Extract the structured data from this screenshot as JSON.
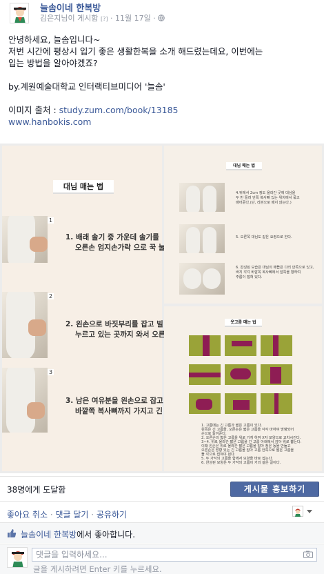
{
  "post": {
    "page_name": "늘솜이네 한복방",
    "author": "김은지님이 게시함",
    "mini_badge": "[?]",
    "dot": "·",
    "date": "11월 17일",
    "date_suffix": "·",
    "lines": [
      "안녕하세요, 늘솜입니다~",
      "저번 시간에 평상시 입기 좋은 생활한복을 소개 해드렸는데요, 이번에는",
      "입는 방법을 알아야겠죠?",
      "",
      "by.계원예술대학교 인터랙티브미디어 '늘솜'",
      ""
    ],
    "source_label": "이미지 출처 : ",
    "source_link": "study.zum.com/book/13185",
    "site_link": "www.hanbokis.com"
  },
  "media": {
    "left": {
      "title": "대님 매는 법",
      "steps": [
        {
          "num": "1",
          "line1": "1. 배래 솔기 중 가운데 솔기를",
          "line2": "오른손 엄지손가락 으로 꾹 눌"
        },
        {
          "num": "2",
          "line1": "2. 왼손으로 바짓부리를 잡고 빌",
          "line2": "누르고 있는 곳까지 와서 오른"
        },
        {
          "num": "3",
          "line1": "3. 남은 여유분을 왼손으로 잡고",
          "line2": "바깥쪽 복사뼈까지 가지고 긴"
        }
      ]
    },
    "top_right": {
      "title": "대님 매는 법",
      "steps": [
        {
          "l1": "4.뒤에서 2cm 정도 올라간 곳에 대님을",
          "l2": "두 번 돌려 안쪽 복사뼈 있는 위치에서 묶고",
          "l3": "매어준다.(단, 리본으로 매지 않는다.)"
        },
        {
          "l1": "5. 오른쪽 대님도 같은 요령으로 한다.",
          "l2": "",
          "l3": ""
        },
        {
          "l1": "6. 완성된 모습은 대님의 매듭은 다리 안쪽으로 있고,",
          "l2": "바지 각각 바깥쪽 복사뼈에서 앞쪽을 향하여",
          "l3": "주름이 접혀 있다."
        }
      ]
    },
    "bottom_right": {
      "title": "옷고름 매는 법",
      "notes": [
        "1. 고름매는 긴 고름과 짧은 고름이 있다.",
        "   왼쪽은 긴 고름을, 오른손은 짧은 고름을 각각 마하여 방향되어",
        "   손으로 들어준다.",
        "2. 오른손의 짧은 고름을 위로 기게 하여 X자 모양으로 교차시킨다.",
        "3~4. 위로 올라간 짧은 고름을 긴 고름 아래에서 감아 위로 뽑는다.",
        "   이때 왼손은 위로 올라간 짧은 고름을 잡아 정은 동을 만들고",
        "   오른손은 방향 있는 긴 고름을 잡아 고름 안쪽으로 짧은 고름을",
        "   돌 각으로 접혀야 된다.",
        "5. 두 가닥의 고름을 함께서 모양을 바로 잡는다.",
        "6. 완성된 모양은 두 가닥의 고름이 거의 같은 길이다."
      ]
    }
  },
  "reach": {
    "text": "38명에게 도달함",
    "boost_label": "게시물 홍보하기"
  },
  "actions": {
    "unlike": "좋아요 취소",
    "comment": "댓글 달기",
    "share": "공유하기",
    "sep": " · "
  },
  "likes": {
    "page": "늘솜이네 한복방",
    "suffix": "에서 좋아합니다."
  },
  "comment": {
    "placeholder": "댓글을 입력하세요...",
    "hint": "글을 게시하려면 Enter 키를 누르세요."
  },
  "colors": {
    "link": "#3b5998",
    "boost_bg": "#4e69a2",
    "ribbon": "#8e1d54",
    "jeogori": "#9aa338"
  }
}
